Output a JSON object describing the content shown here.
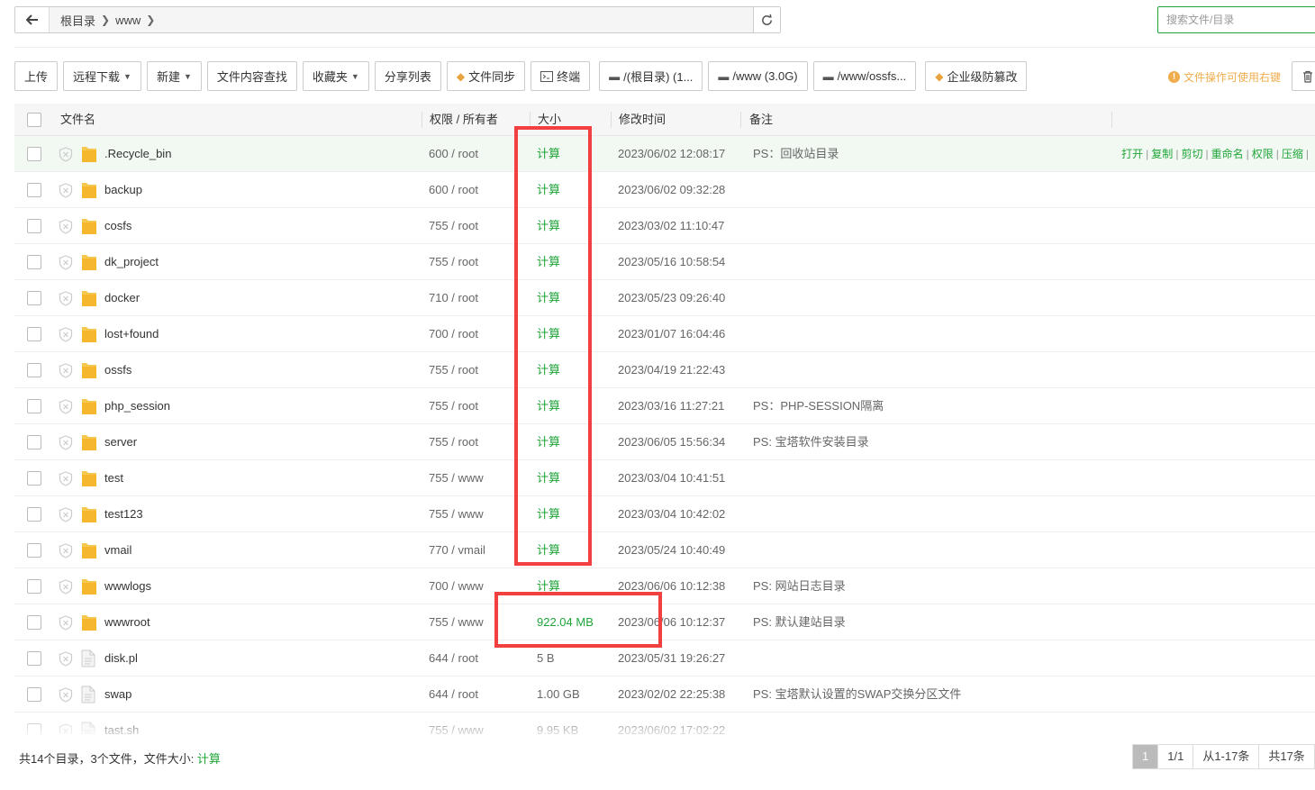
{
  "path": {
    "crumbs": [
      "根目录",
      "www"
    ]
  },
  "search": {
    "placeholder": "搜索文件/目录"
  },
  "toolbar": {
    "upload": "上传",
    "remote_download": "远程下载",
    "new": "新建",
    "content_search": "文件内容查找",
    "favorites": "收藏夹",
    "share_list": "分享列表",
    "file_sync": "文件同步",
    "terminal": "终端",
    "disk_root": "/(根目录) (1...",
    "disk_www": "/www (3.0G)",
    "disk_ossfs": "/www/ossfs...",
    "tamper_proof": "企业级防篡改",
    "tip": "文件操作可使用右键"
  },
  "table": {
    "headers": {
      "name": "文件名",
      "perm_owner": "权限 / 所有者",
      "size": "大小",
      "mtime": "修改时间",
      "note": "备注"
    },
    "row_ops": [
      "打开",
      "复制",
      "剪切",
      "重命名",
      "权限",
      "压缩"
    ],
    "rows": [
      {
        "name": ".Recycle_bin",
        "type": "folder",
        "perm": "600 / root",
        "size": "计算",
        "mtime": "2023/06/02 12:08:17",
        "note": "PS：回收站目录"
      },
      {
        "name": "backup",
        "type": "folder",
        "perm": "600 / root",
        "size": "计算",
        "mtime": "2023/06/02 09:32:28",
        "note": ""
      },
      {
        "name": "cosfs",
        "type": "folder",
        "perm": "755 / root",
        "size": "计算",
        "mtime": "2023/03/02 11:10:47",
        "note": ""
      },
      {
        "name": "dk_project",
        "type": "folder",
        "perm": "755 / root",
        "size": "计算",
        "mtime": "2023/05/16 10:58:54",
        "note": ""
      },
      {
        "name": "docker",
        "type": "folder",
        "perm": "710 / root",
        "size": "计算",
        "mtime": "2023/05/23 09:26:40",
        "note": ""
      },
      {
        "name": "lost+found",
        "type": "folder",
        "perm": "700 / root",
        "size": "计算",
        "mtime": "2023/01/07 16:04:46",
        "note": ""
      },
      {
        "name": "ossfs",
        "type": "folder",
        "perm": "755 / root",
        "size": "计算",
        "mtime": "2023/04/19 21:22:43",
        "note": ""
      },
      {
        "name": "php_session",
        "type": "folder",
        "perm": "755 / root",
        "size": "计算",
        "mtime": "2023/03/16 11:27:21",
        "note": "PS：PHP-SESSION隔离"
      },
      {
        "name": "server",
        "type": "folder",
        "perm": "755 / root",
        "size": "计算",
        "mtime": "2023/06/05 15:56:34",
        "note": "PS: 宝塔软件安装目录"
      },
      {
        "name": "test",
        "type": "folder",
        "perm": "755 / www",
        "size": "计算",
        "mtime": "2023/03/04 10:41:51",
        "note": ""
      },
      {
        "name": "test123",
        "type": "folder",
        "perm": "755 / www",
        "size": "计算",
        "mtime": "2023/03/04 10:42:02",
        "note": ""
      },
      {
        "name": "vmail",
        "type": "folder",
        "perm": "770 / vmail",
        "size": "计算",
        "mtime": "2023/05/24 10:40:49",
        "note": ""
      },
      {
        "name": "wwwlogs",
        "type": "folder",
        "perm": "700 / www",
        "size": "计算",
        "mtime": "2023/06/06 10:12:38",
        "note": "PS: 网站日志目录"
      },
      {
        "name": "wwwroot",
        "type": "folder",
        "perm": "755 / www",
        "size": "922.04 MB",
        "mtime": "2023/06/06 10:12:37",
        "note": "PS: 默认建站目录"
      },
      {
        "name": "disk.pl",
        "type": "file",
        "perm": "644 / root",
        "size": "5 B",
        "mtime": "2023/05/31 19:26:27",
        "note": ""
      },
      {
        "name": "swap",
        "type": "file",
        "perm": "644 / root",
        "size": "1.00 GB",
        "mtime": "2023/02/02 22:25:38",
        "note": "PS: 宝塔默认设置的SWAP交换分区文件"
      },
      {
        "name": "tast.sh",
        "type": "file",
        "perm": "755 / www",
        "size": "9.95 KB",
        "mtime": "2023/06/02 17:02:22",
        "note": ""
      }
    ]
  },
  "footer": {
    "summary_prefix": "共14个目录，3个文件，文件大小: ",
    "summary_calc": "计算",
    "pager": {
      "current": "1",
      "pages": "1/1",
      "range": "从1-17条",
      "total": "共17条"
    }
  },
  "colors": {
    "accent": "#20a53a",
    "annotation": "#f23f3f",
    "tip": "#f0ad4e",
    "folder": "#f7c64d"
  }
}
